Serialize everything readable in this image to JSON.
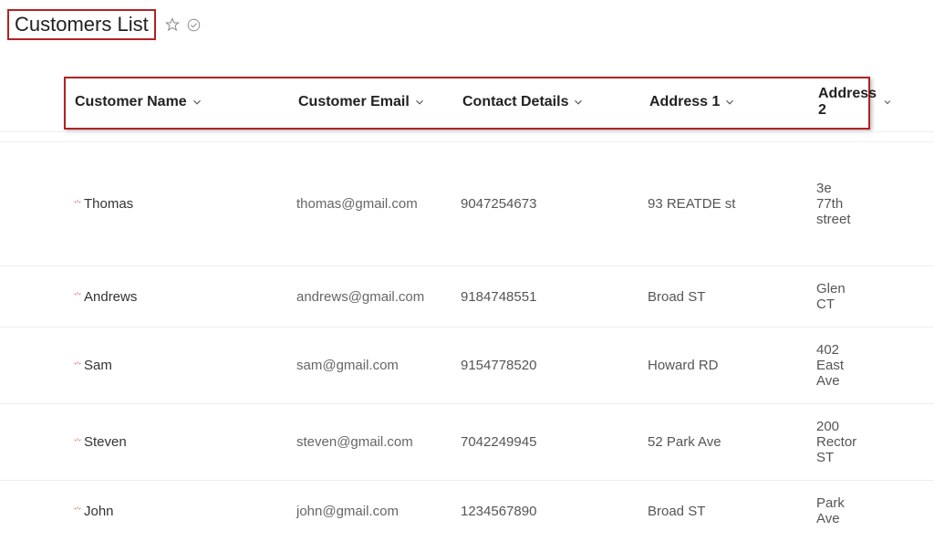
{
  "page": {
    "title": "Customers List"
  },
  "columns": {
    "name": "Customer Name",
    "email": "Customer Email",
    "contact": "Contact Details",
    "addr1": "Address 1",
    "addr2": "Address 2"
  },
  "rows": [
    {
      "name": "Thomas",
      "email": "thomas@gmail.com",
      "contact": "9047254673",
      "addr1": "93 REATDE st",
      "addr2": "3e 77th street"
    },
    {
      "name": "Andrews",
      "email": "andrews@gmail.com",
      "contact": "9184748551",
      "addr1": "Broad ST",
      "addr2": "Glen CT"
    },
    {
      "name": "Sam",
      "email": "sam@gmail.com",
      "contact": "9154778520",
      "addr1": "Howard RD",
      "addr2": "402 East Ave"
    },
    {
      "name": "Steven",
      "email": "steven@gmail.com",
      "contact": "7042249945",
      "addr1": "52 Park Ave",
      "addr2": "200 Rector ST"
    },
    {
      "name": "John",
      "email": "john@gmail.com",
      "contact": "1234567890",
      "addr1": "Broad ST",
      "addr2": "Park Ave"
    }
  ]
}
